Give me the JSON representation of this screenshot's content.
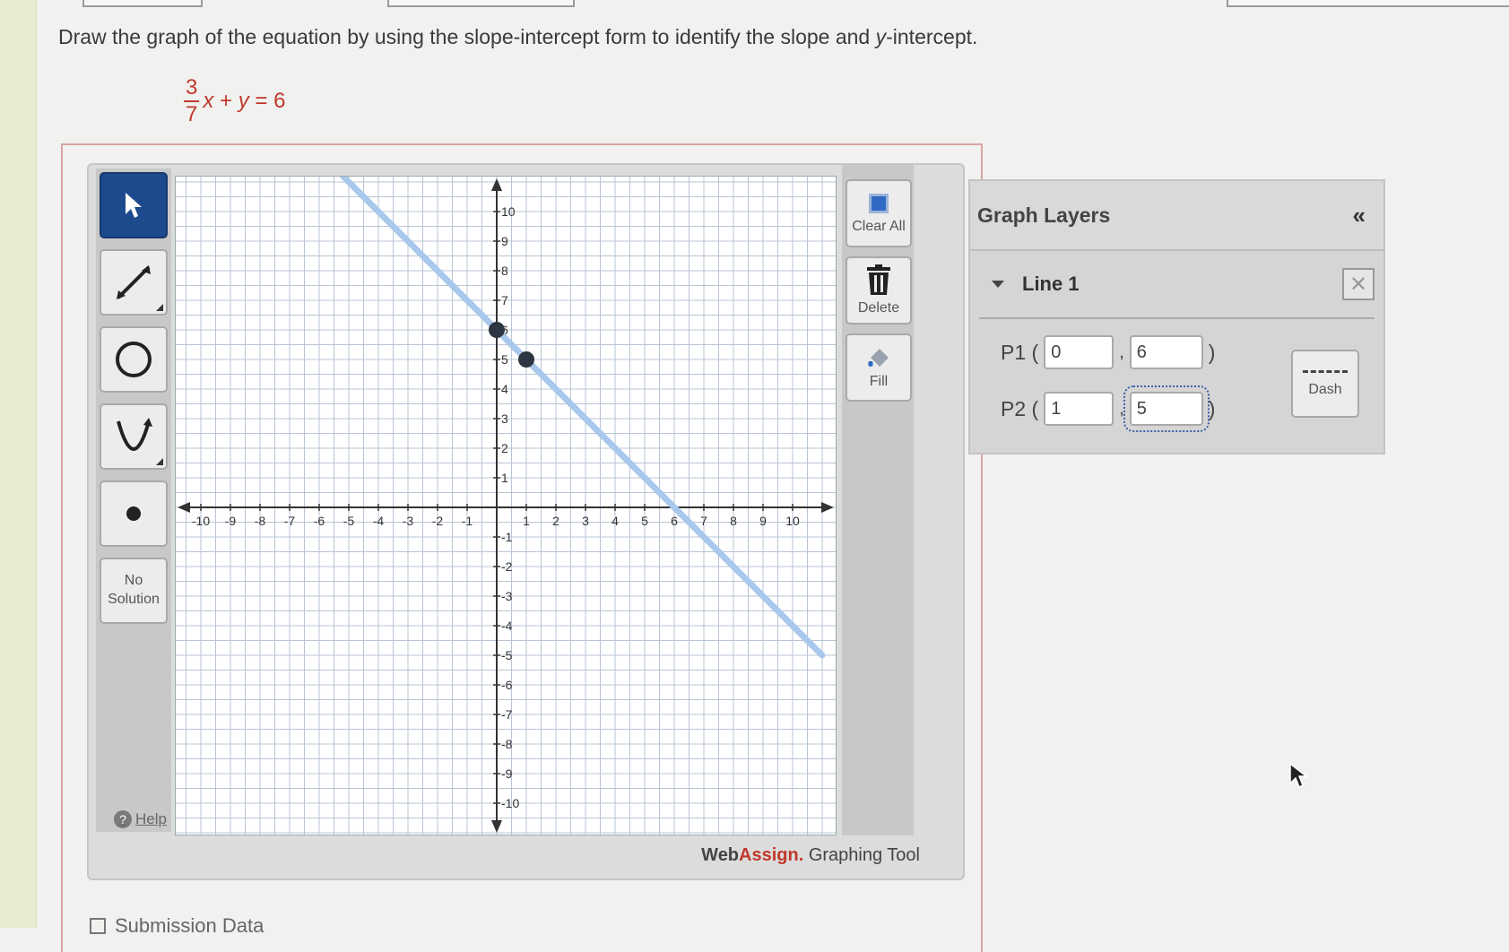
{
  "question": {
    "text_before": "Draw the graph of the equation by using the slope-intercept form to identify the slope and ",
    "var": "y",
    "text_after": "-intercept."
  },
  "equation": {
    "numerator": "3",
    "denominator": "7",
    "rest_x": "x",
    "rest_mid": " + ",
    "rest_y": "y",
    "rest_end": " = 6"
  },
  "left_tools": {
    "no_solution_line1": "No",
    "no_solution_line2": "Solution",
    "help": "Help",
    "help_glyph": "?"
  },
  "right_tools": {
    "clear_all": "Clear All",
    "delete": "Delete",
    "fill": "Fill"
  },
  "brand": {
    "web": "Web",
    "assign": "Assign.",
    "tool": " Graphing Tool"
  },
  "layers": {
    "title": "Graph Layers",
    "collapse": "«",
    "line_name": "Line 1",
    "remove": "✕",
    "p1_label": "P1 (",
    "p2_label": "P2 (",
    "comma": ",",
    "close": ")",
    "p1_x": "0",
    "p1_y": "6",
    "p2_x": "1",
    "p2_y": "5",
    "dash_label": "Dash"
  },
  "submission": "Submission Data",
  "chart_data": {
    "type": "line",
    "xlim": [
      -10,
      10
    ],
    "ylim": [
      -10,
      10
    ],
    "xticks": [
      -10,
      -9,
      -8,
      -7,
      -6,
      -5,
      -4,
      -3,
      -2,
      -1,
      1,
      2,
      3,
      4,
      5,
      6,
      7,
      8,
      9,
      10
    ],
    "yticks": [
      -10,
      -9,
      -8,
      -7,
      -6,
      -5,
      -4,
      -3,
      -2,
      -1,
      1,
      2,
      3,
      4,
      5,
      6,
      7,
      8,
      9,
      10
    ],
    "grid": true,
    "series": [
      {
        "points": [
          [
            -5.2,
            11.2
          ],
          [
            11,
            -5
          ]
        ],
        "color": "#a9c8ec"
      }
    ],
    "markers": [
      {
        "x": 0,
        "y": 6
      },
      {
        "x": 1,
        "y": 5
      }
    ],
    "marker_color": "#2c3540"
  }
}
